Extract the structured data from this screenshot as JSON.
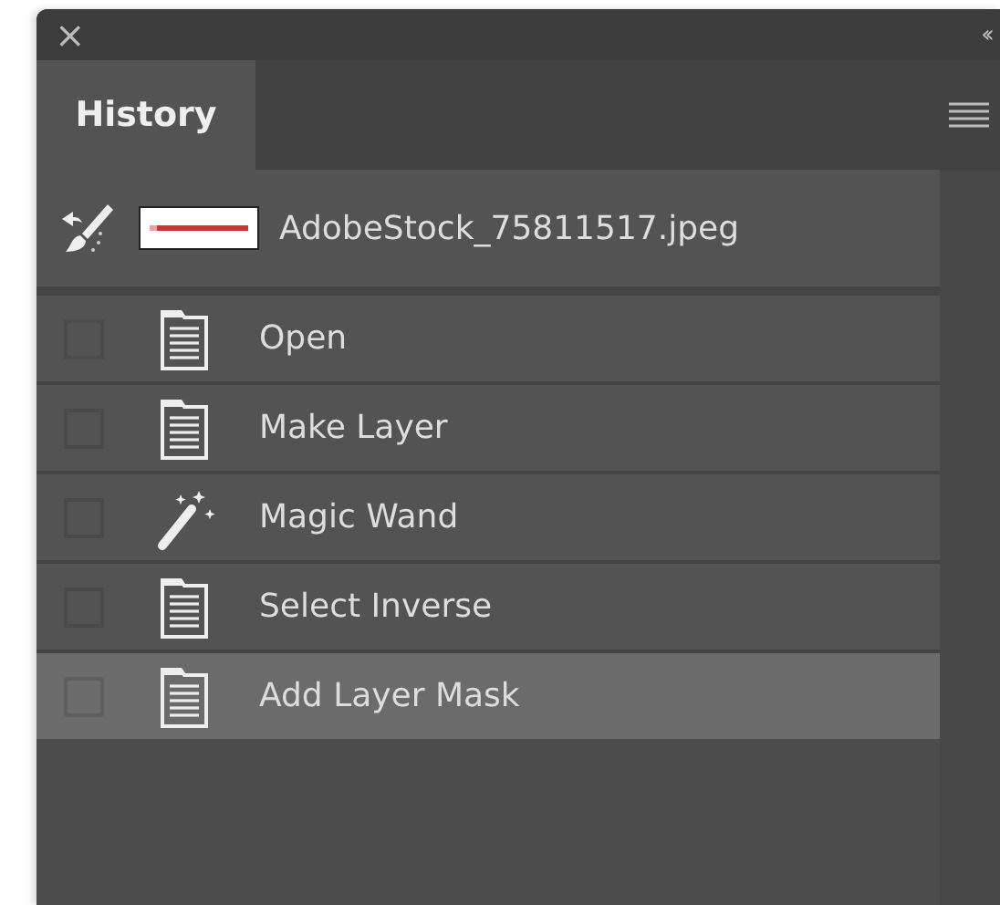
{
  "panel": {
    "close": "×",
    "collapse": "‹‹"
  },
  "tabs": [
    {
      "label": "History",
      "selected": true
    }
  ],
  "snapshot": {
    "name": "AdobeStock_75811517.jpeg"
  },
  "history": [
    {
      "label": "Open",
      "kind": "document",
      "selected": false
    },
    {
      "label": "Make Layer",
      "kind": "document",
      "selected": false
    },
    {
      "label": "Magic Wand",
      "kind": "wand",
      "selected": false
    },
    {
      "label": "Select Inverse",
      "kind": "document",
      "selected": false
    },
    {
      "label": "Add Layer Mask",
      "kind": "document",
      "selected": true
    }
  ]
}
